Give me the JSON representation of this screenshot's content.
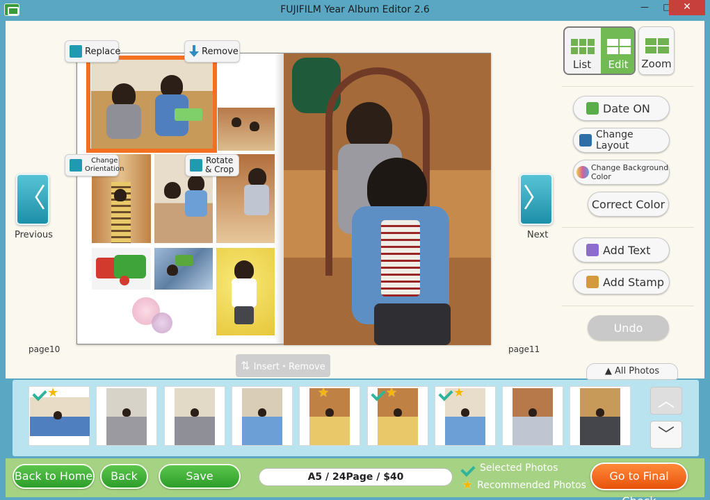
{
  "window": {
    "title": "FUJIFILM Year Album Editor 2.6",
    "min_glyph": "—",
    "max_glyph": "□",
    "close_glyph": "✕"
  },
  "photo_tools": {
    "replace": "Replace",
    "remove": "Remove",
    "change_orientation_1": "Change",
    "change_orientation_2": "Orientation",
    "rotate_crop_1": "Rotate",
    "rotate_crop_2": "& Crop"
  },
  "nav": {
    "previous_glyph": "〈",
    "previous_label": "Previous",
    "next_glyph": "〉",
    "next_label": "Next"
  },
  "pages": {
    "left": "page10",
    "right": "page11"
  },
  "insert_remove": "Insert・Remove",
  "modes": {
    "list": "List",
    "edit": "Edit",
    "zoom": "Zoom"
  },
  "side_buttons": {
    "date": "Date ON",
    "layout": "Change Layout",
    "background": "Change Background Color",
    "correct": "Correct Color",
    "add_text": "Add Text",
    "add_stamp": "Add Stamp",
    "undo": "Undo"
  },
  "all_photos": "▲ All Photos",
  "thumbnails": [
    {
      "selected": true,
      "recommended": true,
      "wide": true
    },
    {
      "selected": false,
      "recommended": false,
      "wide": false
    },
    {
      "selected": false,
      "recommended": false,
      "wide": false
    },
    {
      "selected": false,
      "recommended": false,
      "wide": false
    },
    {
      "selected": false,
      "recommended": true,
      "wide": false
    },
    {
      "selected": true,
      "recommended": true,
      "wide": false
    },
    {
      "selected": true,
      "recommended": true,
      "wide": false
    },
    {
      "selected": false,
      "recommended": false,
      "wide": false
    },
    {
      "selected": false,
      "recommended": false,
      "wide": false
    }
  ],
  "scroll": {
    "up": "︿",
    "down": "﹀"
  },
  "bottom": {
    "back_home": "Back to Home",
    "back": "Back",
    "save": "Save",
    "summary": "A5 / 24Page / $40",
    "selected_legend": "Selected Photos",
    "recommended_legend": "Recommended Photos",
    "final_check": "Go to Final Check"
  },
  "colors": {
    "frame_blue": "#5aa7c3",
    "accent_green": "#71ba54",
    "selection_orange": "#f37021",
    "nav_teal": "#1d8fa8",
    "check_teal": "#2fb39a",
    "star_gold": "#f5b700"
  }
}
